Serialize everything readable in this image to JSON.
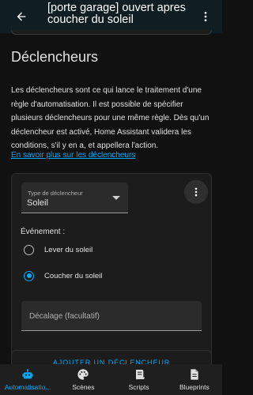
{
  "appbar": {
    "title": "[porte garage] ouvert apres coucher du soleil",
    "back_icon": "arrow-left-icon",
    "menu_icon": "dots-vertical-icon"
  },
  "section": {
    "title": "Déclencheurs",
    "description": "Les déclencheurs sont ce qui lance le traitement d'une règle d'automatisation. Il est possible de spécifier plusieurs déclencheurs pour une même règle. Dès qu'un déclencheur est activé, Home Assistant validera les conditions, s'il y en a, et appellera l'action.",
    "link": "En savoir plus sur les déclencheurs"
  },
  "trigger_card": {
    "type_label": "Type de déclencheur",
    "type_value": "Soleil",
    "event_label": "Événement :",
    "options": [
      {
        "label": "Lever du soleil",
        "checked": false
      },
      {
        "label": "Coucher du soleil",
        "checked": true
      }
    ],
    "offset_placeholder": "Décalage (facultatif)"
  },
  "add_trigger": {
    "label": "AJOUTER UN DÉCLENCHEUR"
  },
  "nav": {
    "items": [
      {
        "label": "Automatisatio...",
        "icon": "robot-icon",
        "active": true
      },
      {
        "label": "Scènes",
        "icon": "palette-icon",
        "active": false
      },
      {
        "label": "Scripts",
        "icon": "script-icon",
        "active": false
      },
      {
        "label": "Blueprints",
        "icon": "blueprint-icon",
        "active": false
      }
    ]
  },
  "colors": {
    "accent": "#03a9f4",
    "header": "#101e24",
    "background": "#111111",
    "card": "#1c1c1c"
  }
}
